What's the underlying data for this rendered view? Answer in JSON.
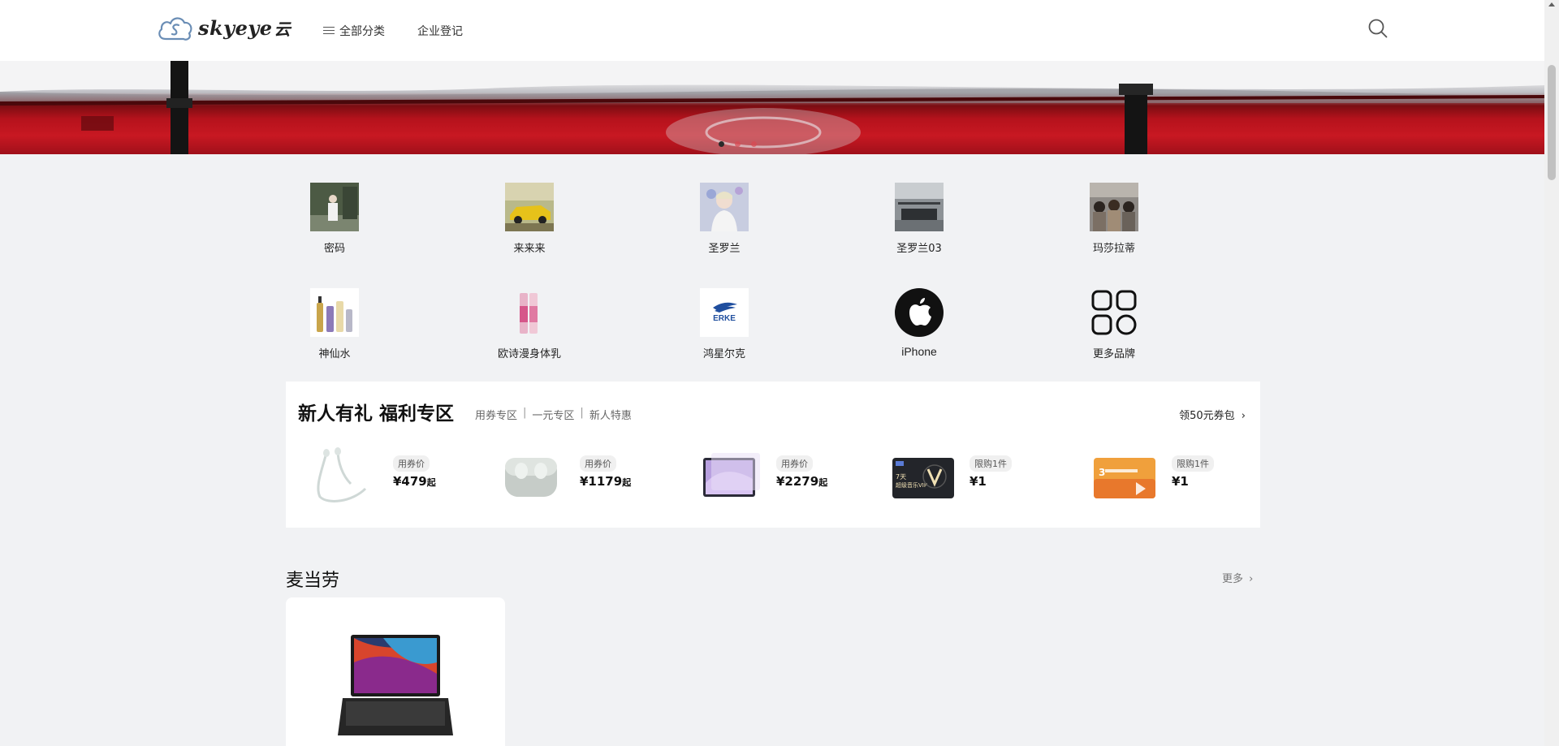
{
  "header": {
    "logo_text": "skyeye",
    "logo_suffix": "云",
    "nav": [
      {
        "label": "全部分类",
        "icon": "menu-icon"
      },
      {
        "label": "企业登记"
      }
    ],
    "search_icon": "search-icon"
  },
  "banner": {
    "slides_total": 3,
    "active_slide": 1
  },
  "brands": [
    {
      "label": "密码"
    },
    {
      "label": "来来来"
    },
    {
      "label": "圣罗兰"
    },
    {
      "label": "圣罗兰03"
    },
    {
      "label": "玛莎拉蒂"
    },
    {
      "label": "神仙水"
    },
    {
      "label": "欧诗漫身体乳"
    },
    {
      "label": "鸿星尔克"
    },
    {
      "label": "iPhone"
    },
    {
      "label": "更多品牌"
    }
  ],
  "promo": {
    "title": "新人有礼 福利专区",
    "tabs": [
      "用券专区",
      "一元专区",
      "新人特惠"
    ],
    "coupon_link": "领50元券包",
    "items": [
      {
        "tag": "用券价",
        "price": "¥479",
        "suffix": "起",
        "image": "earphones"
      },
      {
        "tag": "用券价",
        "price": "¥1179",
        "suffix": "起",
        "image": "earbuds-case"
      },
      {
        "tag": "用券价",
        "price": "¥2279",
        "suffix": "起",
        "image": "tablet"
      },
      {
        "tag": "限购1件",
        "price": "¥1",
        "suffix": "",
        "image": "music-vip-card"
      },
      {
        "tag": "限购1件",
        "price": "¥1",
        "suffix": "",
        "image": "video-vip-card"
      }
    ]
  },
  "section": {
    "title": "麦当劳",
    "more": "更多"
  },
  "products": [
    {
      "image": "laptop"
    }
  ],
  "colors": {
    "background": "#f1f2f4",
    "banner_red": "#c81822"
  }
}
